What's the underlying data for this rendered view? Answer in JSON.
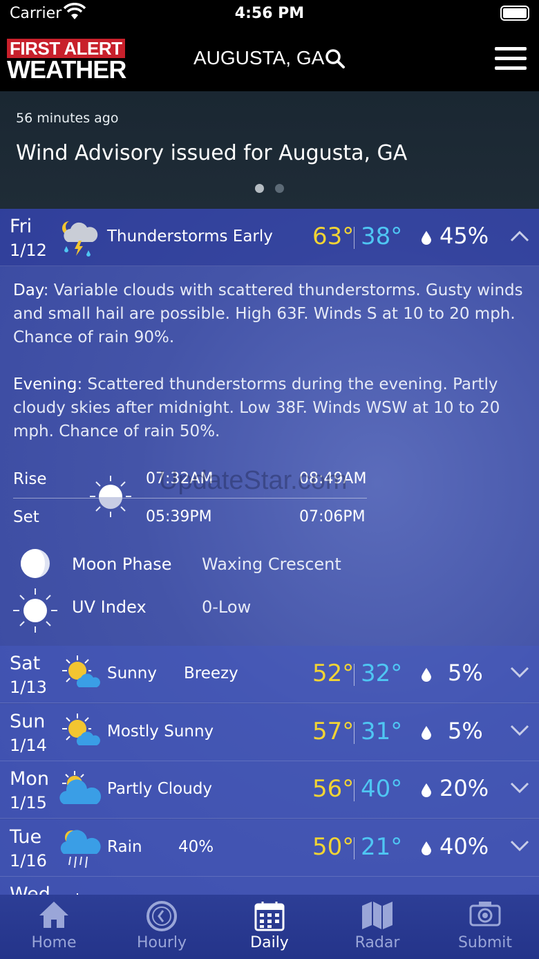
{
  "status_bar": {
    "carrier": "Carrier",
    "time": "4:56 PM"
  },
  "header": {
    "logo_line1": "FIRST ALERT",
    "logo_line2": "WEATHER",
    "location": "AUGUSTA, GA"
  },
  "alert": {
    "time_ago": "56 minutes ago",
    "title": "Wind Advisory issued for Augusta, GA",
    "page_count": 2,
    "active_page": 1
  },
  "colors": {
    "high_temp": "#f2d434",
    "low_temp": "#4fc6f3",
    "tab_bg": "#2d3e96"
  },
  "today": {
    "day": "Fri",
    "date": "1/12",
    "icon": "thunderstorm-icon",
    "condition": "Thunderstorms Early",
    "high": "63°",
    "low": "38°",
    "precip": "45%",
    "day_label": "Day",
    "day_text": ": Variable clouds with scattered thunderstorms. Gusty winds and small hail are possible. High 63F. Winds S at 10 to 20 mph. Chance of rain 90%.",
    "evening_label": "Evening",
    "evening_text": ": Scattered thunderstorms during the evening. Partly cloudy skies after midnight. Low 38F. Winds WSW at 10 to 20 mph. Chance of rain 50%.",
    "rise_label": "Rise",
    "set_label": "Set",
    "sunrise": "07:32AM",
    "sunset": "05:39PM",
    "moonrise": "08:49AM",
    "moonset": "07:06PM",
    "moon_phase_label": "Moon Phase",
    "moon_phase": "Waxing Crescent",
    "uv_label": "UV Index",
    "uv": "0-Low"
  },
  "watermark": "UpdateStar.com",
  "forecast": [
    {
      "day": "Sat",
      "date": "1/13",
      "icon": "sunny-icon",
      "condition": "Sunny",
      "extra": "Breezy",
      "high": "52°",
      "low": "32°",
      "precip": "5%"
    },
    {
      "day": "Sun",
      "date": "1/14",
      "icon": "mostly-sunny-icon",
      "condition": "Mostly Sunny",
      "extra": "",
      "high": "57°",
      "low": "31°",
      "precip": "5%"
    },
    {
      "day": "Mon",
      "date": "1/15",
      "icon": "partly-cloudy-icon",
      "condition": "Partly Cloudy",
      "extra": "",
      "high": "56°",
      "low": "40°",
      "precip": "20%"
    },
    {
      "day": "Tue",
      "date": "1/16",
      "icon": "rain-icon",
      "condition": "Rain",
      "extra": "40%",
      "high": "50°",
      "low": "21°",
      "precip": "40%"
    },
    {
      "day": "Wed",
      "date": "",
      "icon": "sunny-icon",
      "condition": "",
      "extra": "",
      "high": "",
      "low": "",
      "precip": ""
    }
  ],
  "tabs": [
    {
      "label": "Home",
      "icon": "home-icon",
      "active": false
    },
    {
      "label": "Hourly",
      "icon": "clock-icon",
      "active": false
    },
    {
      "label": "Daily",
      "icon": "calendar-icon",
      "active": true
    },
    {
      "label": "Radar",
      "icon": "map-icon",
      "active": false
    },
    {
      "label": "Submit",
      "icon": "camera-icon",
      "active": false
    }
  ]
}
